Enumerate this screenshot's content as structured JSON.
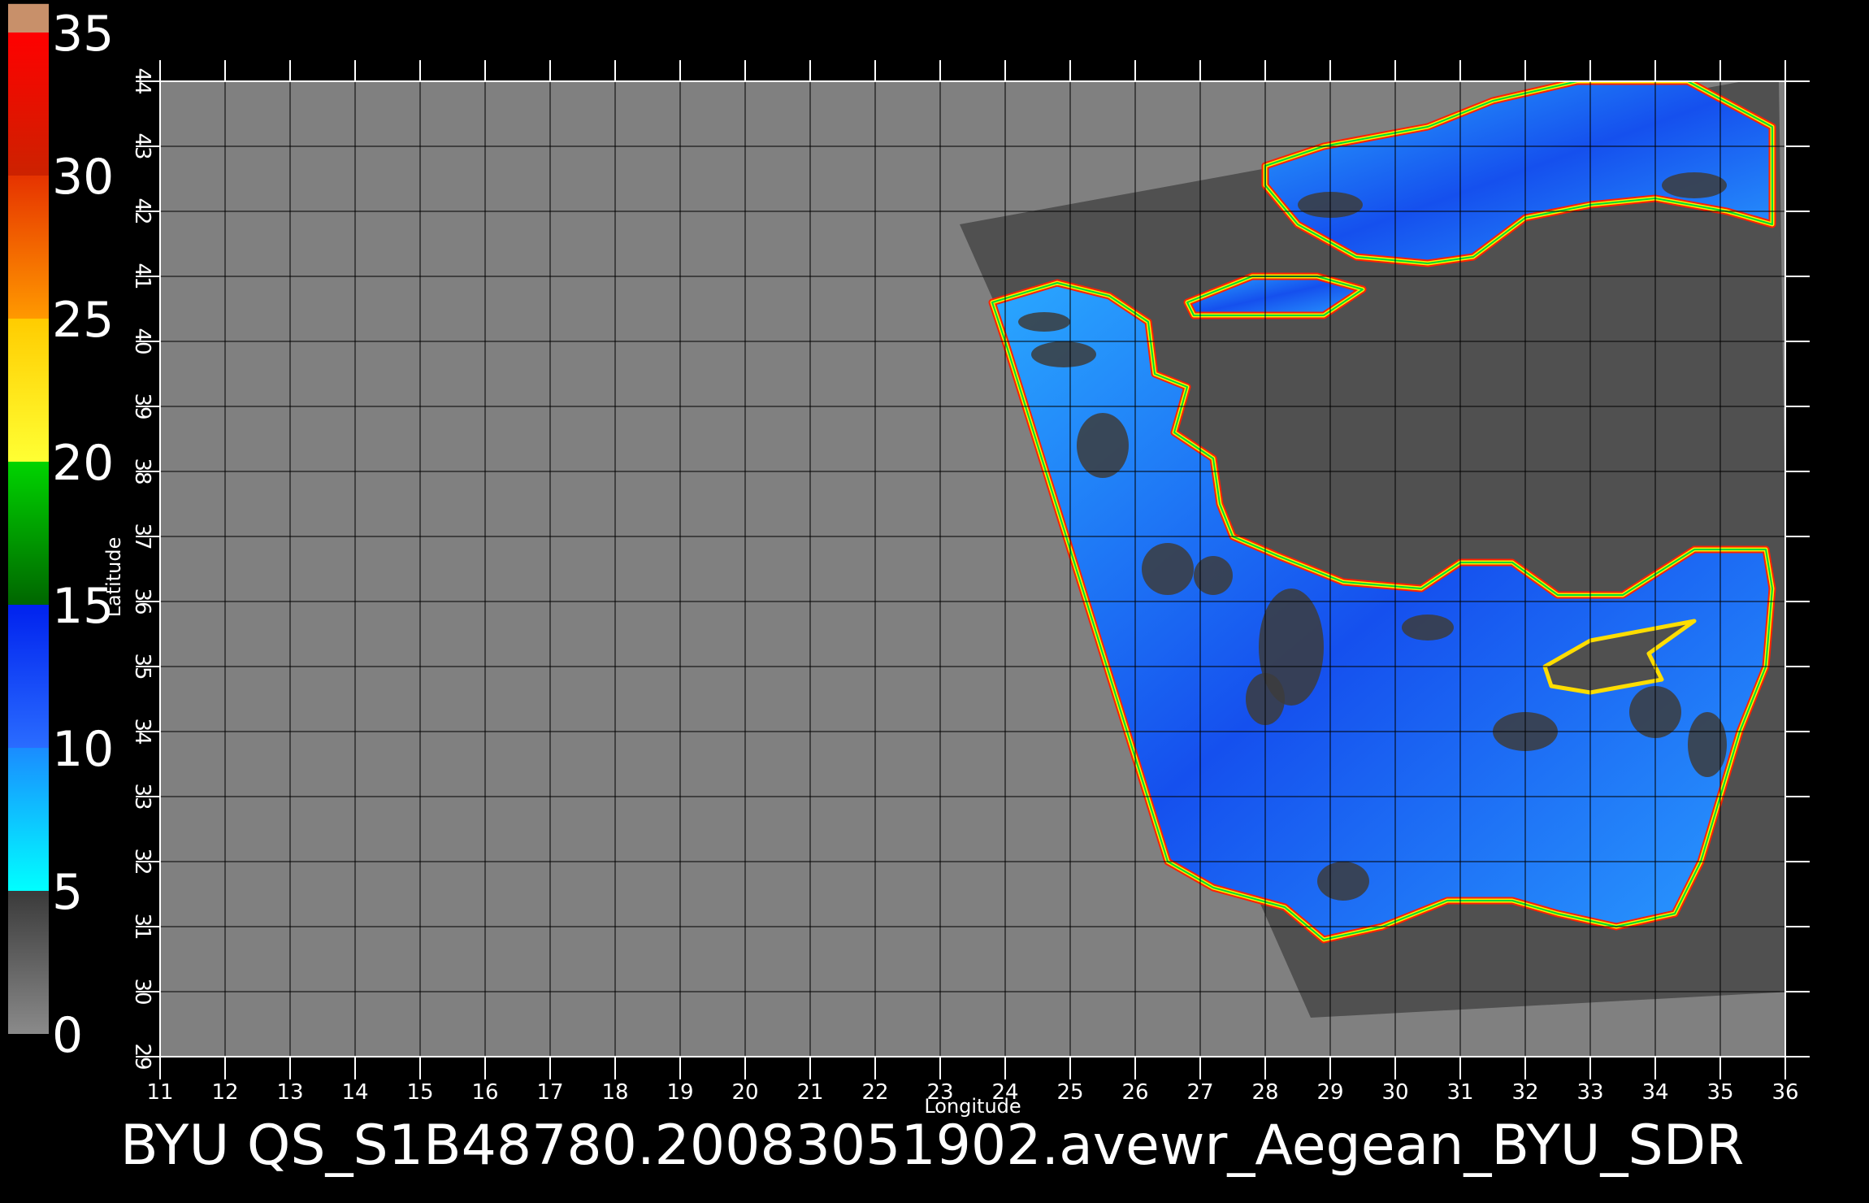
{
  "title": "BYU  QS_S1B48780.20083051902.avewr_Aegean_BYU_SDR",
  "colorbar": {
    "labels": [
      "0",
      "5",
      "10",
      "15",
      "20",
      "25",
      "30",
      "35"
    ],
    "segments": [
      {
        "from": 0,
        "to": 5,
        "top": "#3a3a3a",
        "bottom": "#8a8a8a"
      },
      {
        "from": 5,
        "to": 10,
        "top": "#1a8cff",
        "bottom": "#00ffff"
      },
      {
        "from": 10,
        "to": 15,
        "top": "#0022ee",
        "bottom": "#2a6cff"
      },
      {
        "from": 15,
        "to": 20,
        "top": "#00d400",
        "bottom": "#006600"
      },
      {
        "from": 20,
        "to": 25,
        "top": "#ffcc00",
        "bottom": "#ffff33"
      },
      {
        "from": 25,
        "to": 30,
        "top": "#e63300",
        "bottom": "#ff9900"
      },
      {
        "from": 30,
        "to": 35,
        "top": "#ff0000",
        "bottom": "#cc2200"
      },
      {
        "from": 35,
        "to": 36,
        "top": "#c8906a",
        "bottom": "#c8906a"
      }
    ]
  },
  "map": {
    "xlabel": "Longitude",
    "ylabel": "Latitude",
    "lon_range": [
      11,
      36
    ],
    "lat_range": [
      29,
      44
    ],
    "lon_ticks": [
      "11",
      "12",
      "13",
      "14",
      "15",
      "16",
      "17",
      "18",
      "19",
      "20",
      "21",
      "22",
      "23",
      "24",
      "25",
      "26",
      "27",
      "28",
      "29",
      "30",
      "31",
      "32",
      "33",
      "34",
      "35",
      "36"
    ],
    "lat_ticks": [
      "29",
      "30",
      "31",
      "32",
      "33",
      "34",
      "35",
      "36",
      "37",
      "38",
      "39",
      "40",
      "41",
      "42",
      "43",
      "44"
    ],
    "grid": true,
    "colors": {
      "background": "#000000",
      "no_data": "#808080",
      "swath_land": "#505050",
      "grid": "#000000",
      "ticks": "#ffffff"
    },
    "swath_corners": [
      [
        23.3,
        41.8
      ],
      [
        35.9,
        44.1
      ],
      [
        36.1,
        30.0
      ],
      [
        28.7,
        29.6
      ]
    ],
    "sea_regions": [
      {
        "name": "black-sea",
        "polygon": [
          [
            28.0,
            42.7
          ],
          [
            28.9,
            43.0
          ],
          [
            30.5,
            43.3
          ],
          [
            31.5,
            43.7
          ],
          [
            32.8,
            44.0
          ],
          [
            34.5,
            44.0
          ],
          [
            35.8,
            43.3
          ],
          [
            35.8,
            41.8
          ],
          [
            35.1,
            42.0
          ],
          [
            34.0,
            42.2
          ],
          [
            33.0,
            42.1
          ],
          [
            32.0,
            41.9
          ],
          [
            31.2,
            41.3
          ],
          [
            30.5,
            41.2
          ],
          [
            29.4,
            41.3
          ],
          [
            28.5,
            41.8
          ],
          [
            28.0,
            42.4
          ]
        ]
      },
      {
        "name": "marmara-sea",
        "polygon": [
          [
            26.8,
            40.6
          ],
          [
            27.8,
            41.0
          ],
          [
            28.8,
            41.0
          ],
          [
            29.5,
            40.8
          ],
          [
            28.9,
            40.4
          ],
          [
            27.8,
            40.4
          ],
          [
            26.9,
            40.4
          ]
        ]
      },
      {
        "name": "aegean-mediterranean",
        "polygon": [
          [
            23.8,
            40.6
          ],
          [
            24.8,
            40.9
          ],
          [
            25.6,
            40.7
          ],
          [
            26.2,
            40.3
          ],
          [
            26.3,
            39.5
          ],
          [
            26.8,
            39.3
          ],
          [
            26.6,
            38.6
          ],
          [
            27.2,
            38.2
          ],
          [
            27.3,
            37.5
          ],
          [
            27.5,
            37.0
          ],
          [
            28.2,
            36.7
          ],
          [
            29.2,
            36.3
          ],
          [
            30.4,
            36.2
          ],
          [
            31.0,
            36.6
          ],
          [
            31.8,
            36.6
          ],
          [
            32.5,
            36.1
          ],
          [
            33.5,
            36.1
          ],
          [
            34.6,
            36.8
          ],
          [
            35.7,
            36.8
          ],
          [
            35.8,
            36.2
          ],
          [
            35.7,
            35.0
          ],
          [
            35.3,
            34.0
          ],
          [
            35.0,
            33.0
          ],
          [
            34.7,
            32.0
          ],
          [
            34.3,
            31.2
          ],
          [
            33.4,
            31.0
          ],
          [
            32.5,
            31.2
          ],
          [
            31.8,
            31.4
          ],
          [
            30.8,
            31.4
          ],
          [
            29.8,
            31.0
          ],
          [
            28.9,
            30.8
          ],
          [
            28.3,
            31.3
          ],
          [
            27.2,
            31.6
          ],
          [
            26.5,
            32.0
          ],
          [
            24.0,
            40.0
          ]
        ]
      },
      {
        "name": "cyprus",
        "polygon": [
          [
            32.3,
            35.0
          ],
          [
            33.0,
            35.4
          ],
          [
            34.6,
            35.7
          ],
          [
            33.9,
            35.2
          ],
          [
            34.1,
            34.8
          ],
          [
            33.0,
            34.6
          ],
          [
            32.4,
            34.7
          ]
        ],
        "hole": true
      }
    ],
    "cloud_patches": [
      [
        24.6,
        40.3,
        0.4,
        0.15
      ],
      [
        24.9,
        39.8,
        0.5,
        0.2
      ],
      [
        25.5,
        38.4,
        0.4,
        0.5
      ],
      [
        26.5,
        36.5,
        0.4,
        0.4
      ],
      [
        27.2,
        36.4,
        0.3,
        0.3
      ],
      [
        28.4,
        35.3,
        0.5,
        0.9
      ],
      [
        28.0,
        34.5,
        0.3,
        0.4
      ],
      [
        29.2,
        31.7,
        0.4,
        0.3
      ],
      [
        30.5,
        35.6,
        0.4,
        0.2
      ],
      [
        32.0,
        34.0,
        0.5,
        0.3
      ],
      [
        34.0,
        34.3,
        0.4,
        0.4
      ],
      [
        34.8,
        33.8,
        0.3,
        0.5
      ],
      [
        29.0,
        42.1,
        0.5,
        0.2
      ],
      [
        34.6,
        42.4,
        0.5,
        0.2
      ]
    ]
  }
}
